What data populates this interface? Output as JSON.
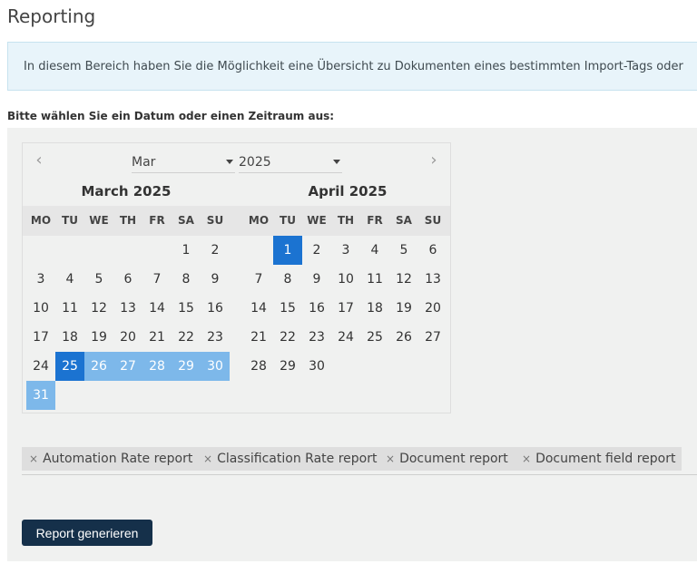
{
  "page_title": "Reporting",
  "info_text": "In diesem Bereich haben Sie die Möglichkeit eine Übersicht zu Dokumenten eines bestimmten Import-Tags oder",
  "prompt": "Bitte wählen Sie ein Datum oder einen Zeitraum aus:",
  "calendar": {
    "prev_icon": "chevron-left-icon",
    "next_icon": "chevron-right-icon",
    "month_select": "Mar",
    "year_select": "2025",
    "weekdays": [
      "MO",
      "TU",
      "WE",
      "TH",
      "FR",
      "SA",
      "SU"
    ],
    "left": {
      "title": "March 2025",
      "weeks": [
        [
          "",
          "",
          "",
          "",
          "",
          "1",
          "2"
        ],
        [
          "3",
          "4",
          "5",
          "6",
          "7",
          "8",
          "9"
        ],
        [
          "10",
          "11",
          "12",
          "13",
          "14",
          "15",
          "16"
        ],
        [
          "17",
          "18",
          "19",
          "20",
          "21",
          "22",
          "23"
        ],
        [
          "24",
          "25",
          "26",
          "27",
          "28",
          "29",
          "30"
        ],
        [
          "31",
          "",
          "",
          "",
          "",
          "",
          ""
        ]
      ]
    },
    "right": {
      "title": "April 2025",
      "weeks": [
        [
          "",
          "1",
          "2",
          "3",
          "4",
          "5",
          "6"
        ],
        [
          "7",
          "8",
          "9",
          "10",
          "11",
          "12",
          "13"
        ],
        [
          "14",
          "15",
          "16",
          "17",
          "18",
          "19",
          "20"
        ],
        [
          "21",
          "22",
          "23",
          "24",
          "25",
          "26",
          "27"
        ],
        [
          "28",
          "29",
          "30",
          "",
          "",
          "",
          ""
        ]
      ]
    },
    "range_start": "2025-03-25",
    "range_end": "2025-04-01",
    "colors": {
      "selected": "#1b73d1",
      "in_range": "#7db8ea"
    }
  },
  "tags": [
    {
      "remove": "×",
      "label": "Automation Rate report"
    },
    {
      "remove": "×",
      "label": "Classification Rate report"
    },
    {
      "remove": "×",
      "label": "Document report"
    },
    {
      "remove": "×",
      "label": "Document field report"
    }
  ],
  "generate_button": "Report generieren"
}
